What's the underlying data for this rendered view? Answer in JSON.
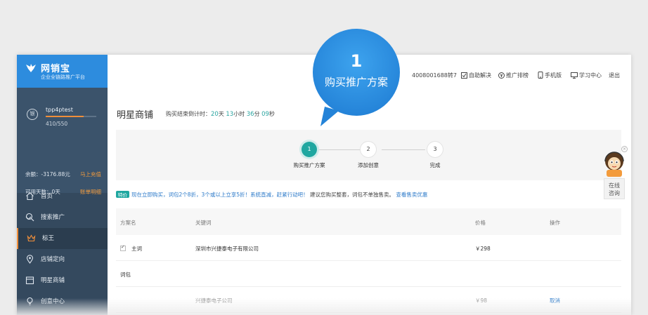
{
  "brand": {
    "name": "网销宝",
    "subtitle": "企业全链路推广平台"
  },
  "user": {
    "name": "tpp4ptest",
    "score": "410/550",
    "progress": 0.75,
    "balance_label": "余额：-3176.88元",
    "balance_link": "马上充值",
    "days_label": "可用天数：0天",
    "days_link": "账单明细",
    "medal": "银"
  },
  "nav": [
    {
      "label": "首页",
      "icon": "home-icon"
    },
    {
      "label": "搜索推广",
      "icon": "search-icon"
    },
    {
      "label": "标王",
      "icon": "crown-icon"
    },
    {
      "label": "店铺定向",
      "icon": "location-icon"
    },
    {
      "label": "明星商铺",
      "icon": "store-icon"
    },
    {
      "label": "创意中心",
      "icon": "bulb-icon"
    }
  ],
  "topbar": {
    "phone": "4008001688转7",
    "self_help": "自助解决",
    "ranking": "推广排榜",
    "mobile": "手机版",
    "learn": "学习中心",
    "logout": "退出"
  },
  "page": {
    "title": "明星商铺",
    "countdown_label": "购买结束倒计时：",
    "days": "20",
    "days_unit": "天",
    "hours": "13",
    "hours_unit": "小时",
    "minutes": "36",
    "minutes_unit": "分",
    "seconds": "09",
    "seconds_unit": "秒"
  },
  "steps": [
    {
      "num": "1",
      "label": "购买推广方案"
    },
    {
      "num": "2",
      "label": "添加创意"
    },
    {
      "num": "3",
      "label": "完成"
    }
  ],
  "promo": {
    "tag": "特价",
    "text": "现在立即购买，词包2个8折，3个或以上立享5折！系统直减，赶紧行动吧！",
    "note": "建议您购买整套，词包不单独售卖。",
    "link": "查看售卖优惠"
  },
  "table": {
    "headers": [
      "方案名",
      "关键词",
      "价格",
      "操作"
    ],
    "main_label": "主词",
    "main_keyword": "深圳市兴捷泰电子有限公司",
    "main_price": "￥298",
    "pack_label": "词包",
    "pack_keyword": "兴捷泰电子公司",
    "pack_price": "￥98",
    "pack_action": "取消"
  },
  "bubble": {
    "num": "1",
    "text": "购买推广方案"
  },
  "online": {
    "line1": "在线",
    "line2": "咨询"
  },
  "colors": {
    "accent": "#2d8cde",
    "teal": "#1fa7a0",
    "orange": "#f08e3a",
    "sidebar": "#34495e"
  }
}
